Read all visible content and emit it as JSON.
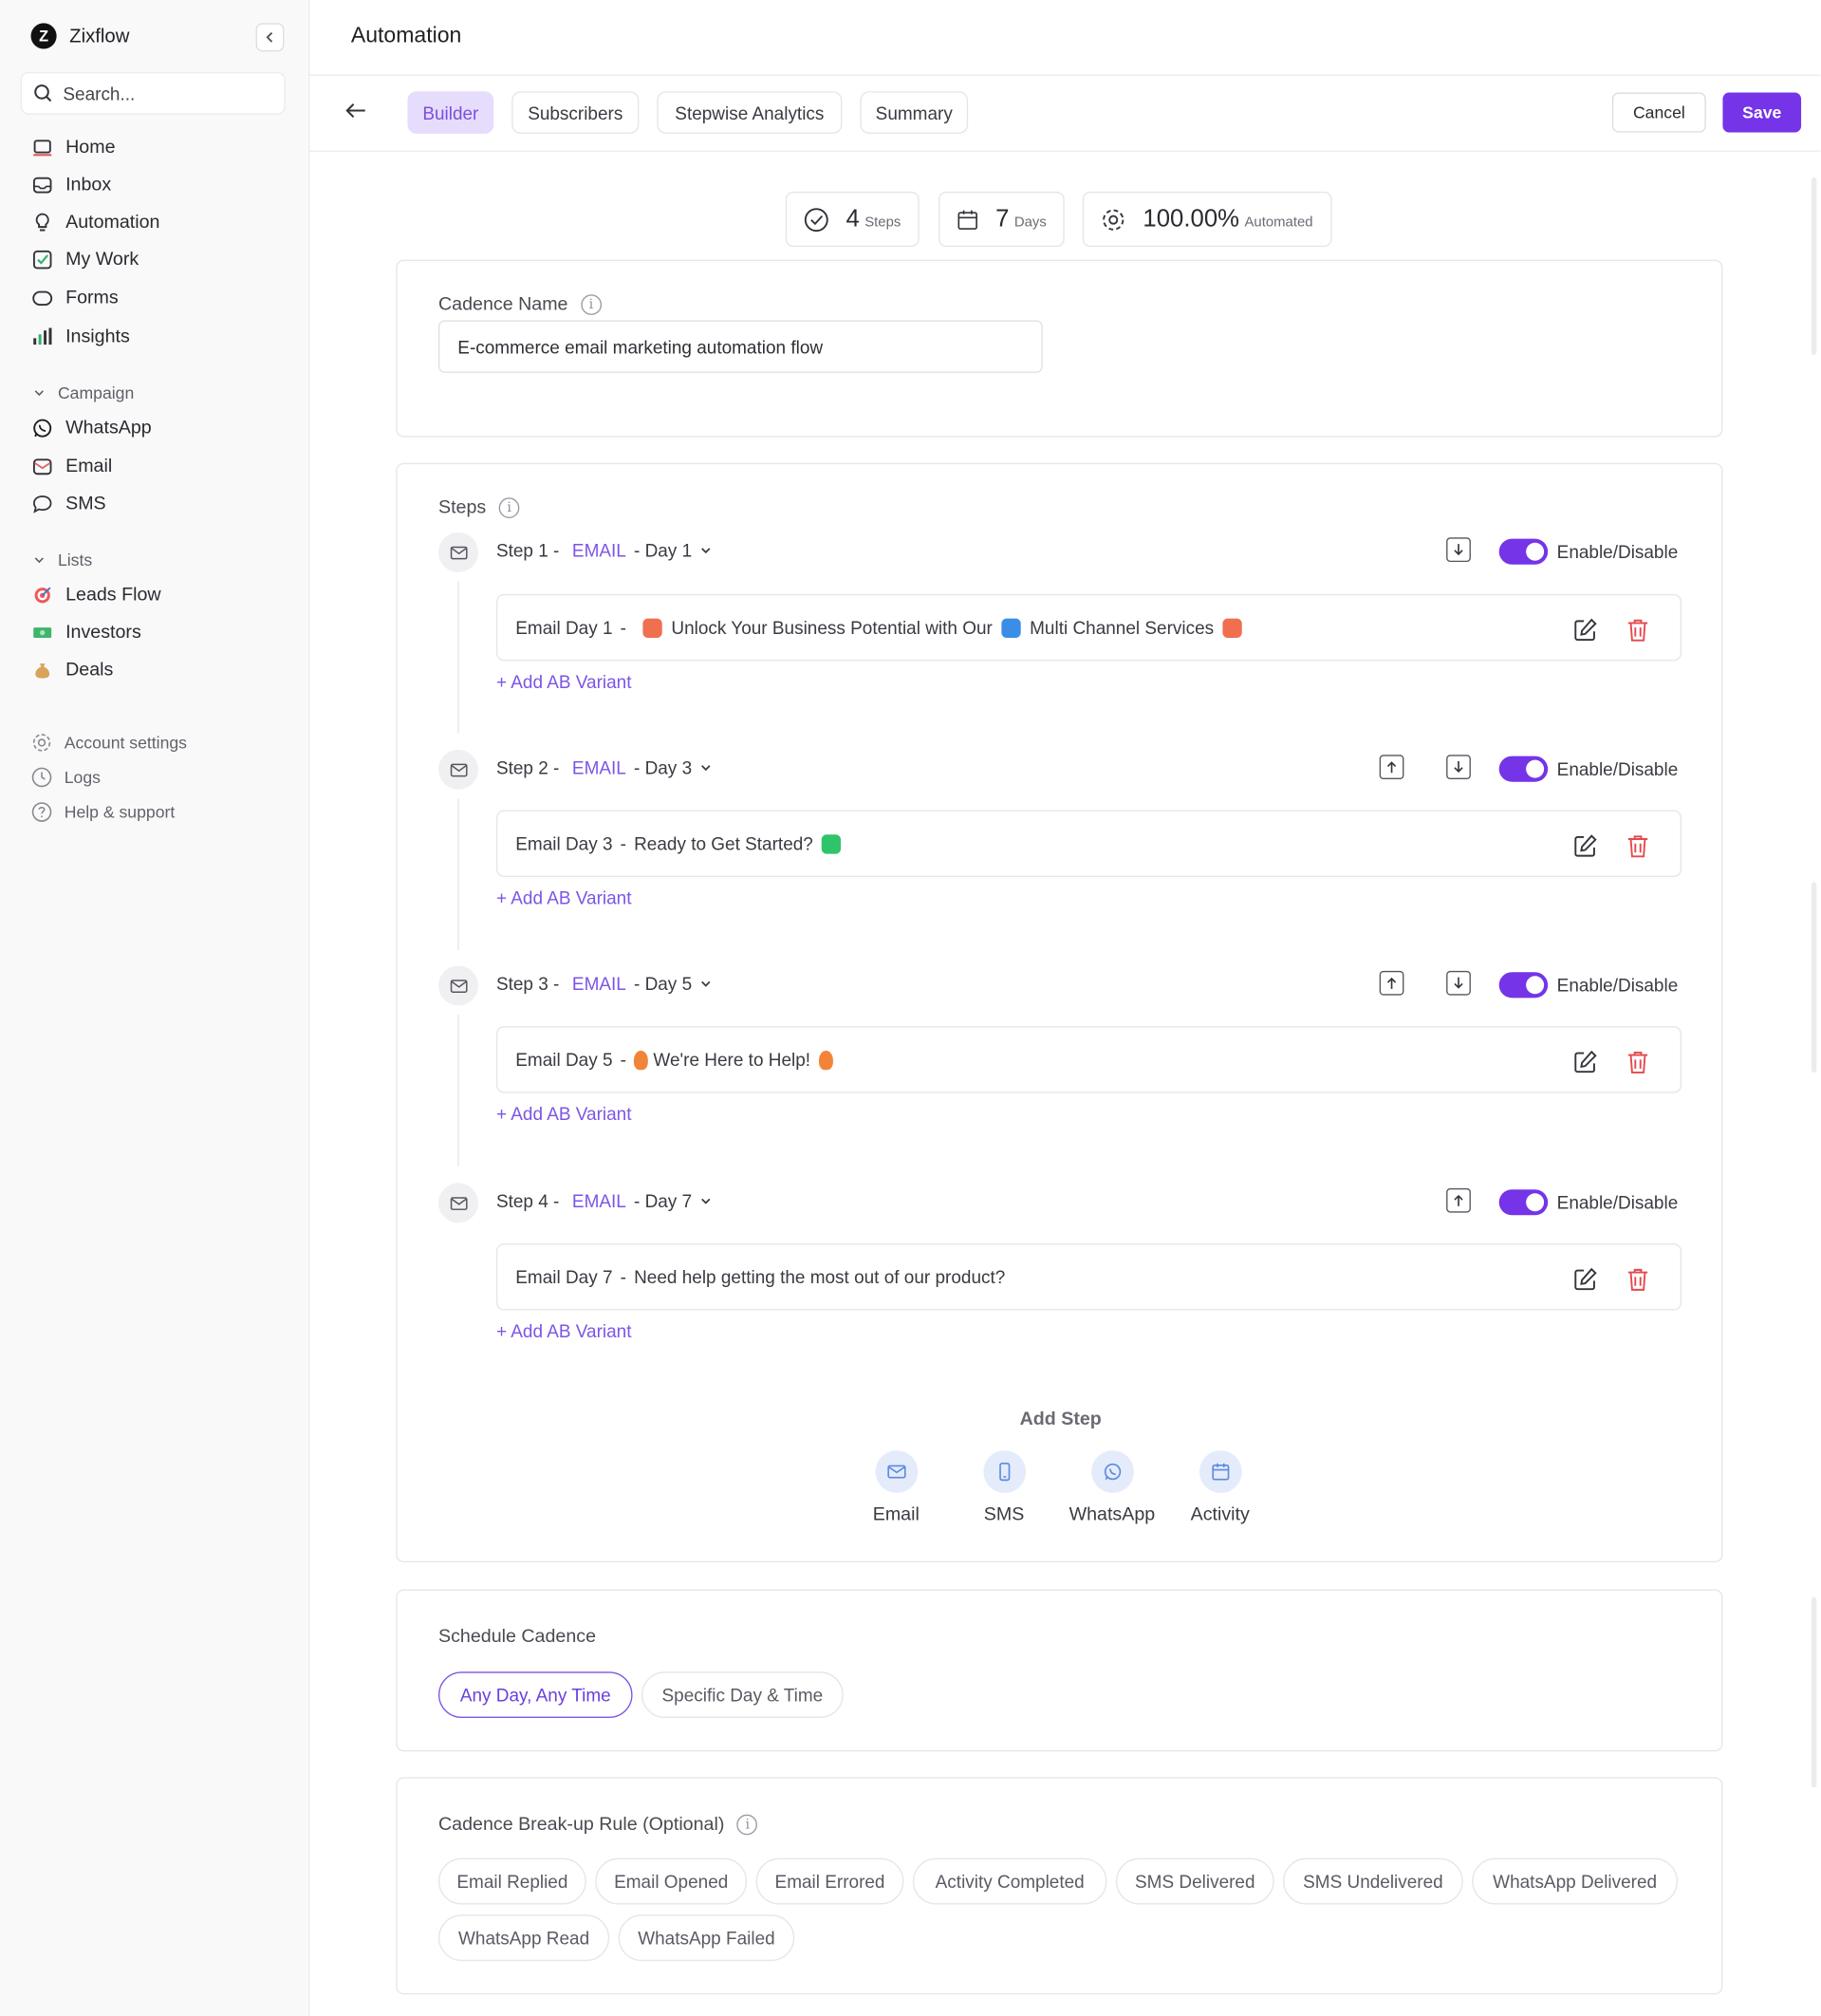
{
  "app": {
    "brand": "Zixflow",
    "search_placeholder": "Search..."
  },
  "sidebar": {
    "main_items": [
      {
        "label": "Home",
        "icon": "home-icon"
      },
      {
        "label": "Inbox",
        "icon": "inbox-icon"
      },
      {
        "label": "Automation",
        "icon": "bulb-icon"
      },
      {
        "label": "My Work",
        "icon": "checkbox-icon"
      },
      {
        "label": "Forms",
        "icon": "form-icon"
      },
      {
        "label": "Insights",
        "icon": "bar-chart-icon"
      }
    ],
    "campaign_header": "Campaign",
    "campaign_items": [
      {
        "label": "WhatsApp",
        "icon": "whatsapp-icon"
      },
      {
        "label": "Email",
        "icon": "mail-icon"
      },
      {
        "label": "SMS",
        "icon": "chat-bubble-icon"
      }
    ],
    "lists_header": "Lists",
    "list_items": [
      {
        "label": "Leads Flow",
        "icon": "target-emoji-icon"
      },
      {
        "label": "Investors",
        "icon": "money-emoji-icon"
      },
      {
        "label": "Deals",
        "icon": "money-bag-emoji-icon"
      }
    ],
    "util_items": [
      {
        "label": "Account settings",
        "icon": "gear-icon"
      },
      {
        "label": "Logs",
        "icon": "clock-icon"
      },
      {
        "label": "Help & support",
        "icon": "question-icon"
      }
    ]
  },
  "header": {
    "title": "Automation",
    "tabs": [
      "Builder",
      "Subscribers",
      "Stepwise Analytics",
      "Summary"
    ],
    "active_tab": "Builder",
    "cancel_label": "Cancel",
    "save_label": "Save"
  },
  "stats": {
    "steps_value": "4",
    "steps_unit": "Steps",
    "days_value": "7",
    "days_unit": "Days",
    "automated_value": "100.00%",
    "automated_unit": "Automated"
  },
  "cadence": {
    "name_label": "Cadence Name",
    "name_value": "E-commerce email marketing automation flow"
  },
  "steps_section": {
    "label": "Steps",
    "toggle_label": "Enable/Disable",
    "add_variant_label": "+ Add AB Variant",
    "steps": [
      {
        "step": "Step 1 -",
        "channel": "EMAIL",
        "day": "- Day 1",
        "msg_prefix": "Email Day 1",
        "msg_text": "Unlock Your Business Potential with Our",
        "msg_text2": "Multi Channel Services",
        "enabled": true
      },
      {
        "step": "Step 2 -",
        "channel": "EMAIL",
        "day": "- Day 3",
        "msg_prefix": "Email Day 3",
        "msg_text": "Ready to Get Started?",
        "enabled": true
      },
      {
        "step": "Step 3 -",
        "channel": "EMAIL",
        "day": "- Day 5",
        "msg_prefix": "Email Day 5",
        "msg_text": "We're Here to Help!",
        "enabled": true
      },
      {
        "step": "Step 4 -",
        "channel": "EMAIL",
        "day": "- Day 7",
        "msg_prefix": "Email Day 7",
        "msg_text": "Need help getting the most out of our product?",
        "enabled": true
      }
    ],
    "add_step_title": "Add Step",
    "add_step_options": [
      "Email",
      "SMS",
      "WhatsApp",
      "Activity"
    ]
  },
  "schedule": {
    "title": "Schedule Cadence",
    "options": [
      "Any Day, Any Time",
      "Specific Day & Time"
    ],
    "selected": "Any Day, Any Time"
  },
  "breakup": {
    "title": "Cadence Break-up Rule (Optional)",
    "rules": [
      "Email Replied",
      "Email Opened",
      "Email Errored",
      "Activity Completed",
      "SMS Delivered",
      "SMS Undelivered",
      "WhatsApp Delivered",
      "WhatsApp Read",
      "WhatsApp Failed"
    ]
  },
  "colors": {
    "accent": "#7534e8",
    "channel_text": "#7c55e4",
    "delete": "#e5484d",
    "tab_active_bg": "#e6dcfb"
  }
}
